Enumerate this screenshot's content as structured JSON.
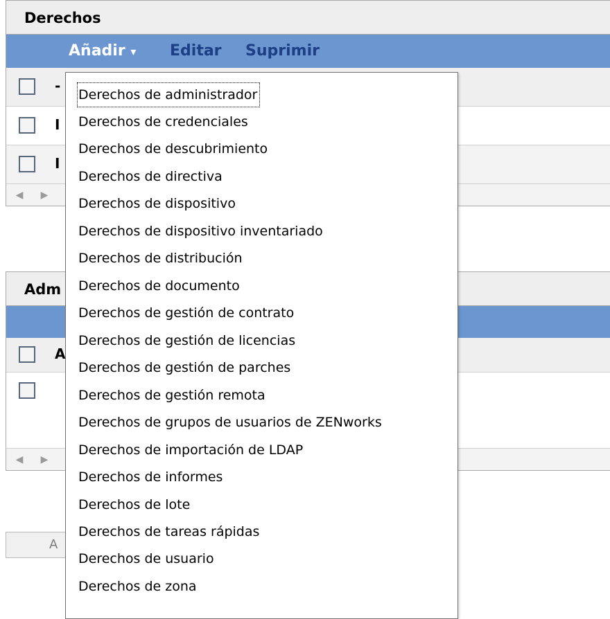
{
  "panel_rights": {
    "title": "Derechos",
    "toolbar": {
      "add": "Añadir",
      "add_caret": "▾",
      "edit": "Editar",
      "delete": "Suprimir"
    },
    "header_stub": "-",
    "row_stubs": [
      "I",
      "I"
    ]
  },
  "panel_admin": {
    "title_fragment": "Adm",
    "header_stub": "A"
  },
  "button_fragment": "A",
  "dropdown": {
    "items": [
      "Derechos de administrador",
      "Derechos de credenciales",
      "Derechos de descubrimiento",
      "Derechos de directiva",
      "Derechos de dispositivo",
      "Derechos de dispositivo inventariado",
      "Derechos de distribución",
      "Derechos de documento",
      "Derechos de gestión de contrato",
      "Derechos de gestión de licencias",
      "Derechos de gestión de parches",
      "Derechos de gestión remota",
      "Derechos de grupos de usuarios de ZENworks",
      "Derechos de importación de LDAP",
      "Derechos de informes",
      "Derechos de lote",
      "Derechos de tareas rápidas",
      "Derechos de usuario",
      "Derechos de zona"
    ]
  },
  "colors": {
    "toolbar": "#6b96cf",
    "menu_border": "#6f6f6f",
    "link_dark": "#1c3f86"
  },
  "icons": {
    "scroll_left": "triangle-left-icon",
    "scroll_right": "triangle-right-icon"
  }
}
